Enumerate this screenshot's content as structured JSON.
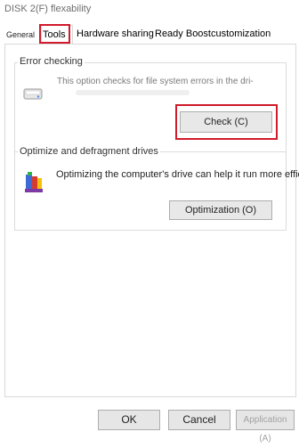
{
  "window": {
    "title": "DISK 2(F) flexability"
  },
  "tabs": [
    {
      "label": "General"
    },
    {
      "label": "Tools"
    },
    {
      "label": "Hardware sharing"
    },
    {
      "label": "Ready Boost"
    },
    {
      "label": "customization"
    }
  ],
  "error_checking": {
    "group_title": "Error checking",
    "description": "This option checks for file system errors in the dri-",
    "button_label": "Check (C)",
    "icon": "drive-icon"
  },
  "optimize": {
    "group_title": "Optimize and defragment drives",
    "description": "Optimizing the computer's drive can help it run more effici",
    "button_label": "Optimization (O)",
    "icon": "defrag-icon"
  },
  "footer": {
    "ok_label": "OK",
    "cancel_label": "Cancel",
    "apply_label": "Application (A)"
  },
  "colors": {
    "highlight": "#d11a2a"
  }
}
